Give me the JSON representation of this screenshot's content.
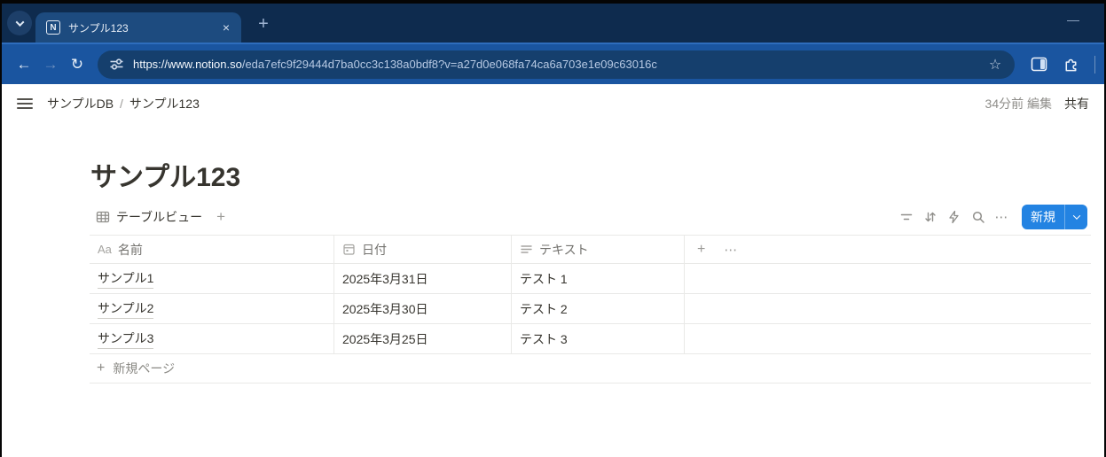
{
  "colors": {
    "chrome_tabstrip_bg": "#0e2b4e",
    "chrome_active_tab_bg": "#1d4b7f",
    "chrome_toolbar_bg": "#1a55a0",
    "chrome_urlbar_bg": "#153f6d",
    "notion_accent_blue": "#2383e2",
    "text_primary": "#37352f",
    "text_secondary": "#8f8e8a",
    "table_border": "#e9e9e7"
  },
  "browser": {
    "tab": {
      "favicon_letter": "N",
      "title": "サンプル123",
      "close_glyph": "×"
    },
    "new_tab_glyph": "+",
    "minimize_glyph": "—",
    "nav": {
      "back_glyph": "←",
      "forward_glyph": "→",
      "reload_glyph": "↻"
    },
    "urlbar": {
      "origin": "https://www.notion.so",
      "path": "/eda7efc9f29444d7ba0cc3c138a0bdf8?v=a27d0e068fa74ca6a703e1e09c63016c",
      "bookmark_glyph": "☆"
    }
  },
  "notion": {
    "header": {
      "breadcrumb_root": "サンプルDB",
      "breadcrumb_separator": "/",
      "breadcrumb_current": "サンプル123",
      "edited_label": "34分前 編集",
      "share_label": "共有"
    },
    "page_title": "サンプル123",
    "view_bar": {
      "view_label": "テーブルビュー",
      "add_view_glyph": "+",
      "more_glyph": "⋯",
      "new_button_label": "新規"
    },
    "table": {
      "columns": [
        {
          "id": "name",
          "icon": "Aa",
          "label": "名前"
        },
        {
          "id": "date",
          "icon": "calendar",
          "label": "日付"
        },
        {
          "id": "text",
          "icon": "text-lines",
          "label": "テキスト"
        }
      ],
      "add_column_glyph": "+",
      "header_more_glyph": "⋯",
      "rows": [
        {
          "name": "サンプル1",
          "date": "2025年3月31日",
          "text": "テスト 1"
        },
        {
          "name": "サンプル2",
          "date": "2025年3月30日",
          "text": "テスト 2"
        },
        {
          "name": "サンプル3",
          "date": "2025年3月25日",
          "text": "テスト 3"
        }
      ],
      "new_page_glyph": "+",
      "new_page_label": "新規ページ"
    }
  }
}
